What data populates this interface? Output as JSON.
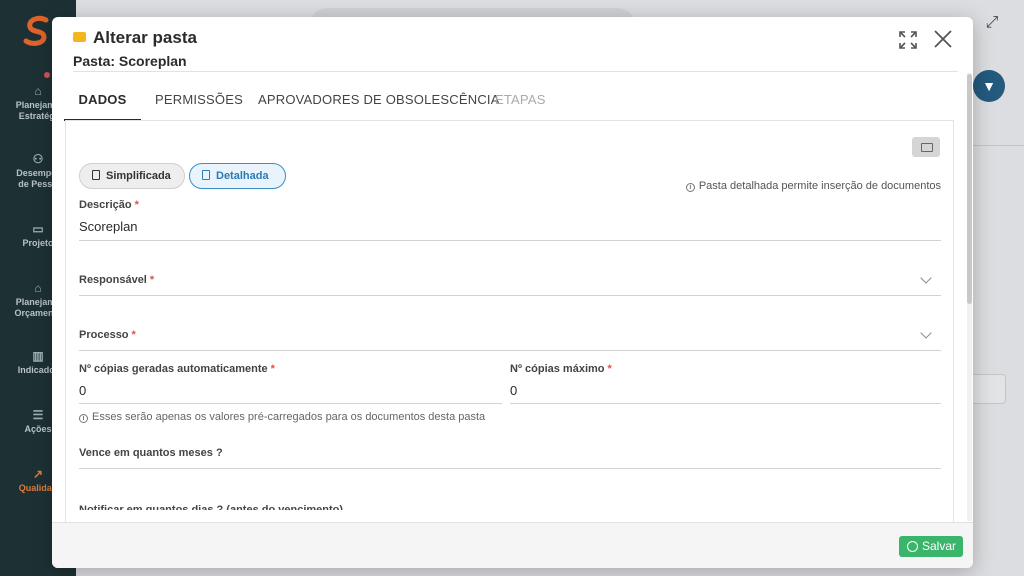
{
  "sidebar": {
    "items": [
      {
        "label": "Planejame\nEstratégi",
        "icon": "home-icon"
      },
      {
        "label": "Desemper\nde Pesso",
        "icon": "people-icon"
      },
      {
        "label": "Projeto",
        "icon": "briefcase-icon"
      },
      {
        "label": "Planejame\nOrçamenta",
        "icon": "bank-icon"
      },
      {
        "label": "Indicador",
        "icon": "bar-chart-icon"
      },
      {
        "label": "Ações",
        "icon": "list-icon"
      },
      {
        "label": "Qualidad",
        "icon": "trend-icon"
      }
    ],
    "active_color": "#e07b3c",
    "bg_color": "#1d3134"
  },
  "modal": {
    "title": "Alterar pasta",
    "subtitle": "Pasta: Scoreplan",
    "tabs": [
      {
        "label": "DADOS",
        "state": "active"
      },
      {
        "label": "PERMISSÕES",
        "state": "normal"
      },
      {
        "label": "APROVADORES DE OBSOLESCÊNCIA",
        "state": "normal"
      },
      {
        "label": "ETAPAS",
        "state": "disabled"
      }
    ],
    "mode_toggle": {
      "simplificada": "Simplificada",
      "detalhada": "Detalhada",
      "selected": "Detalhada"
    },
    "mode_hint": "Pasta detalhada permite inserção de documentos",
    "fields": {
      "descricao": {
        "label": "Descrição",
        "required": "*",
        "value": "Scoreplan"
      },
      "responsavel": {
        "label": "Responsável",
        "required": "*",
        "value": ""
      },
      "processo": {
        "label": "Processo",
        "required": "*",
        "value": ""
      },
      "copias_auto": {
        "label": "Nº cópias geradas automaticamente",
        "required": "*",
        "value": "0"
      },
      "copias_max": {
        "label": "Nº cópias máximo",
        "required": "*",
        "value": "0"
      },
      "copias_hint": "Esses serão apenas os valores pré-carregados para os documentos desta pasta",
      "vence": {
        "label": "Vence em quantos meses ?",
        "value": ""
      },
      "notificar": {
        "label": "Notificar em quantos dias ? (antes do vencimento)"
      }
    },
    "footer": {
      "save_label": "Salvar"
    },
    "colors": {
      "accent": "#3a8fc9",
      "save": "#3bb56c",
      "required": "#d9534f",
      "folder": "#f0b81c"
    }
  }
}
